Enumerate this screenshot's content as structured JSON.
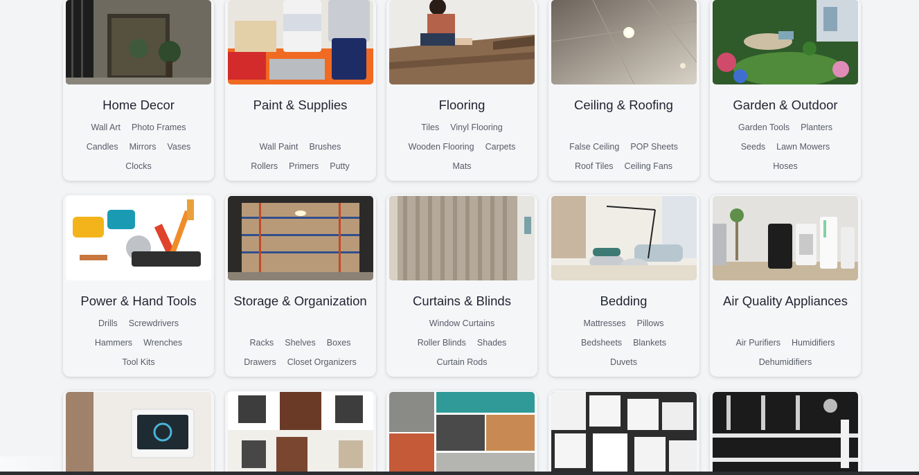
{
  "categories": [
    {
      "title": "Home Decor",
      "icon": "home-decor-image",
      "subs": [
        "Wall Art",
        "Photo Frames",
        "Candles",
        "Mirrors",
        "Vases",
        "Clocks"
      ]
    },
    {
      "title": "Paint & Supplies",
      "icon": "paint-supplies-image",
      "subs": [
        "Wall Paint",
        "Brushes",
        "Rollers",
        "Primers",
        "Putty"
      ]
    },
    {
      "title": "Flooring",
      "icon": "flooring-image",
      "subs": [
        "Tiles",
        "Vinyl Flooring",
        "Wooden Flooring",
        "Carpets",
        "Mats"
      ]
    },
    {
      "title": "Ceiling & Roofing",
      "icon": "ceiling-roofing-image",
      "subs": [
        "False Ceiling",
        "POP Sheets",
        "Roof Tiles",
        "Ceiling Fans"
      ]
    },
    {
      "title": "Garden & Outdoor",
      "icon": "garden-outdoor-image",
      "subs": [
        "Garden Tools",
        "Planters",
        "Seeds",
        "Lawn Mowers",
        "Hoses"
      ]
    },
    {
      "title": "Power & Hand Tools",
      "icon": "tools-image",
      "subs": [
        "Drills",
        "Screwdrivers",
        "Hammers",
        "Wrenches",
        "Tool Kits"
      ]
    },
    {
      "title": "Storage & Organization",
      "icon": "storage-image",
      "subs": [
        "Racks",
        "Shelves",
        "Boxes",
        "Drawers",
        "Closet Organizers"
      ]
    },
    {
      "title": "Curtains & Blinds",
      "icon": "curtains-image",
      "subs": [
        "Window Curtains",
        "Roller Blinds",
        "Shades",
        "Curtain Rods"
      ]
    },
    {
      "title": "Bedding",
      "icon": "bedding-image",
      "subs": [
        "Mattresses",
        "Pillows",
        "Bedsheets",
        "Blankets",
        "Duvets"
      ]
    },
    {
      "title": "Air Quality Appliances",
      "icon": "air-quality-image",
      "subs": [
        "Air Purifiers",
        "Humidifiers",
        "Dehumidifiers"
      ]
    }
  ],
  "partial_row": [
    {
      "icon": "smart-home-image"
    },
    {
      "icon": "doors-windows-image"
    },
    {
      "icon": "building-materials-image"
    },
    {
      "icon": "switches-sockets-image"
    },
    {
      "icon": "bathroom-fittings-image"
    }
  ]
}
